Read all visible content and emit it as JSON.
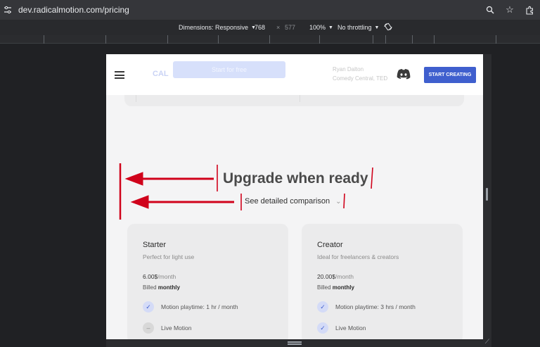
{
  "browser": {
    "url": "dev.radicalmotion.com/pricing",
    "icons": [
      "tune-icon",
      "zoom-icon",
      "star-icon",
      "extensions-icon"
    ]
  },
  "devtools": {
    "dimensions_label": "Dimensions: Responsive",
    "width": "768",
    "times": "×",
    "height": "577",
    "zoom": "100%",
    "throttling": "No throttling",
    "rotate_icon": "rotate-icon"
  },
  "nav": {
    "ghost_logo_text": "CAL",
    "ghost_button": "Start for free",
    "ghost_name": "Ryan Dalton",
    "ghost_role": "Comedy Central, TED",
    "cta": "START CREATING"
  },
  "hero": {
    "heading": "Upgrade when ready",
    "subheading": "See detailed comparison",
    "chevron": "⌄"
  },
  "plans": [
    {
      "name": "Starter",
      "desc": "Perfect for light use",
      "price": "6.00$",
      "unit": "/month",
      "billed_prefix": "Billed ",
      "billed": "monthly",
      "features": [
        {
          "label": "Motion playtime: 1 hr / month",
          "included": true
        },
        {
          "label": "Live Motion",
          "included": false
        }
      ]
    },
    {
      "name": "Creator",
      "desc": "Ideal for freelancers & creators",
      "price": "20.00$",
      "unit": "/month",
      "billed_prefix": "Billed ",
      "billed": "monthly",
      "features": [
        {
          "label": "Motion playtime: 3 hrs / month",
          "included": true
        },
        {
          "label": "Live Motion",
          "included": true
        }
      ]
    }
  ],
  "colors": {
    "accent": "#3f5fce",
    "annotation": "#d0021b"
  }
}
